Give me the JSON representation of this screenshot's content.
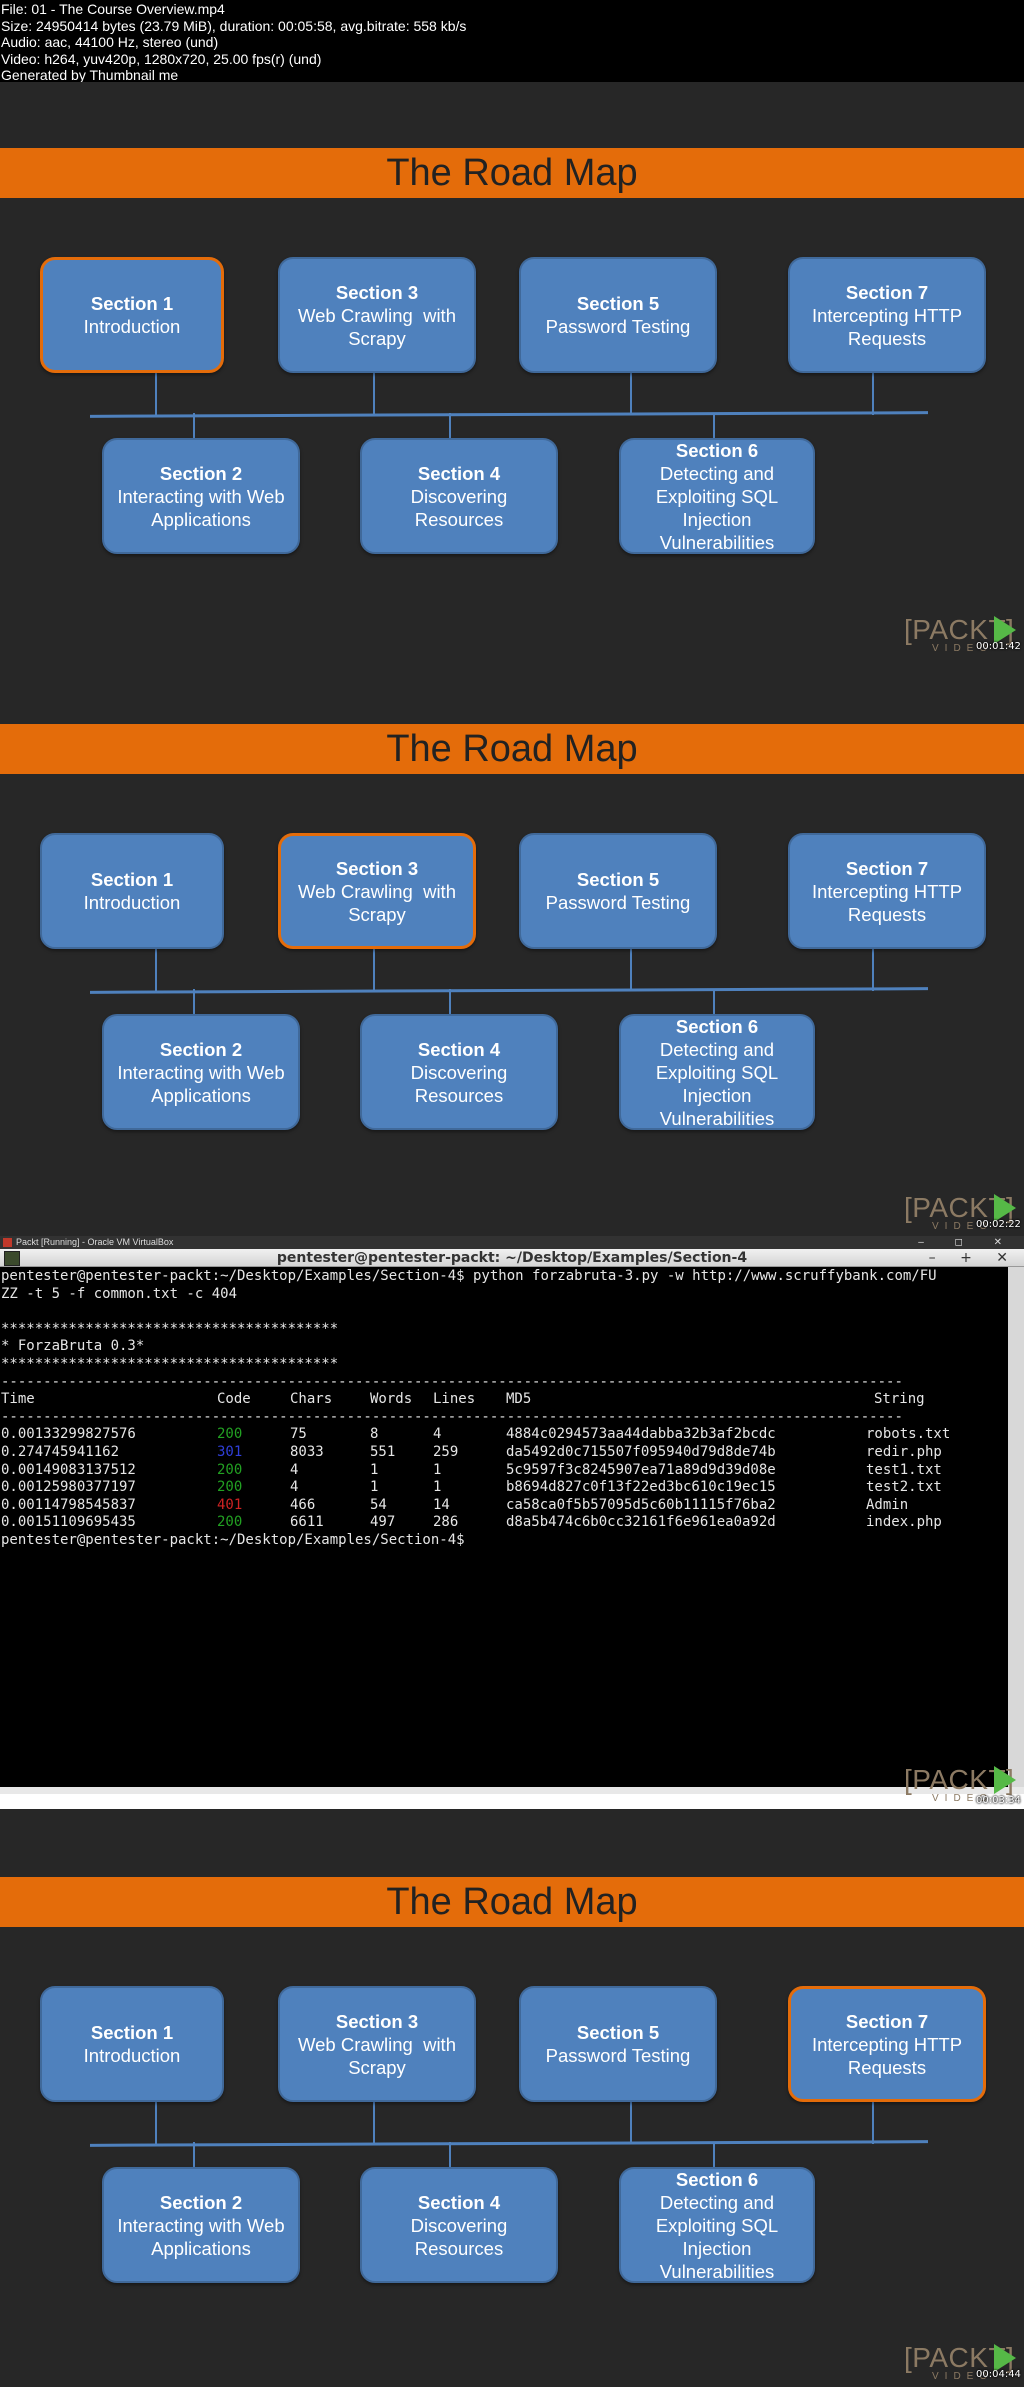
{
  "header": {
    "lines": [
      "File: 01 - The Course Overview.mp4",
      "Size: 24950414 bytes (23.79 MiB), duration: 00:05:58, avg.bitrate: 558 kb/s",
      "Audio: aac, 44100 Hz, stereo (und)",
      "Video: h264, yuv420p, 1280x720, 25.00 fps(r) (und)",
      "Generated by Thumbnail me"
    ]
  },
  "slide": {
    "title": "The Road Map",
    "sections": [
      {
        "num": "Section 1",
        "lines": [
          "Introduction"
        ]
      },
      {
        "num": "Section 3",
        "lines": [
          "Web Crawling  with",
          "Scrapy"
        ]
      },
      {
        "num": "Section 5",
        "lines": [
          "Password Testing"
        ]
      },
      {
        "num": "Section 7",
        "lines": [
          "Intercepting HTTP",
          "Requests"
        ]
      },
      {
        "num": "Section 2",
        "lines": [
          "Interacting with Web",
          "Applications"
        ]
      },
      {
        "num": "Section 4",
        "lines": [
          "Discovering",
          "Resources"
        ]
      },
      {
        "num": "Section 6",
        "lines": [
          "Detecting and",
          "Exploiting SQL",
          "Injection",
          "Vulnerabilities"
        ]
      }
    ],
    "logo": {
      "word": "[PACKT]",
      "sub": "VIDEO"
    }
  },
  "frames": [
    {
      "timestamp": "00:01:42",
      "active": "Section 1"
    },
    {
      "timestamp": "00:02:22",
      "active": "Section 3"
    },
    {
      "timestamp": "00:03:34"
    },
    {
      "timestamp": "00:04:44",
      "active": "Section 7"
    }
  ],
  "terminal": {
    "vbox_title": "Packt [Running] - Oracle VM VirtualBox",
    "vbox_controls": "– ◻ ✕",
    "window_title": "pentester@pentester-packt: ~/Desktop/Examples/Section-4",
    "window_controls": "– + ✕",
    "command_line": "pentester@pentester-packt:~/Desktop/Examples/Section-4$ python forzabruta-3.py -w http://www.scruffybank.com/FU",
    "command_wrap": "ZZ -t 5 -f common.txt -c 404",
    "stars": "****************************************",
    "banner": "* ForzaBruta 0.3*",
    "dashes": "-----------------------------------------------------------------------------------------------------------",
    "columns": [
      "Time",
      "Code",
      "Chars",
      "Words",
      "Lines",
      "MD5",
      "String"
    ],
    "rows": [
      [
        "0.00133299827576",
        "200",
        "75",
        "8",
        "4",
        "4884c0294573aa44dabba32b3af2bcdc",
        "robots.txt"
      ],
      [
        "0.274745941162",
        "301",
        "8033",
        "551",
        "259",
        "da5492d0c715507f095940d79d8de74b",
        "redir.php"
      ],
      [
        "0.00149083137512",
        "200",
        "4",
        "1",
        "1",
        "5c9597f3c8245907ea71a89d9d39d08e",
        "test1.txt"
      ],
      [
        "0.00125980377197",
        "200",
        "4",
        "1",
        "1",
        "b8694d827c0f13f22ed3bc610c19ec15",
        "test2.txt"
      ],
      [
        "0.00114798545837",
        "401",
        "466",
        "54",
        "14",
        "ca58ca0f5b57095d5c60b11115f76ba2",
        "Admin"
      ],
      [
        "0.00151109695435",
        "200",
        "6611",
        "497",
        "286",
        "d8a5b474c6b0cc32161f6e961ea0a92d",
        "index.php"
      ]
    ],
    "prompt": "pentester@pentester-packt:~/Desktop/Examples/Section-4$"
  }
}
